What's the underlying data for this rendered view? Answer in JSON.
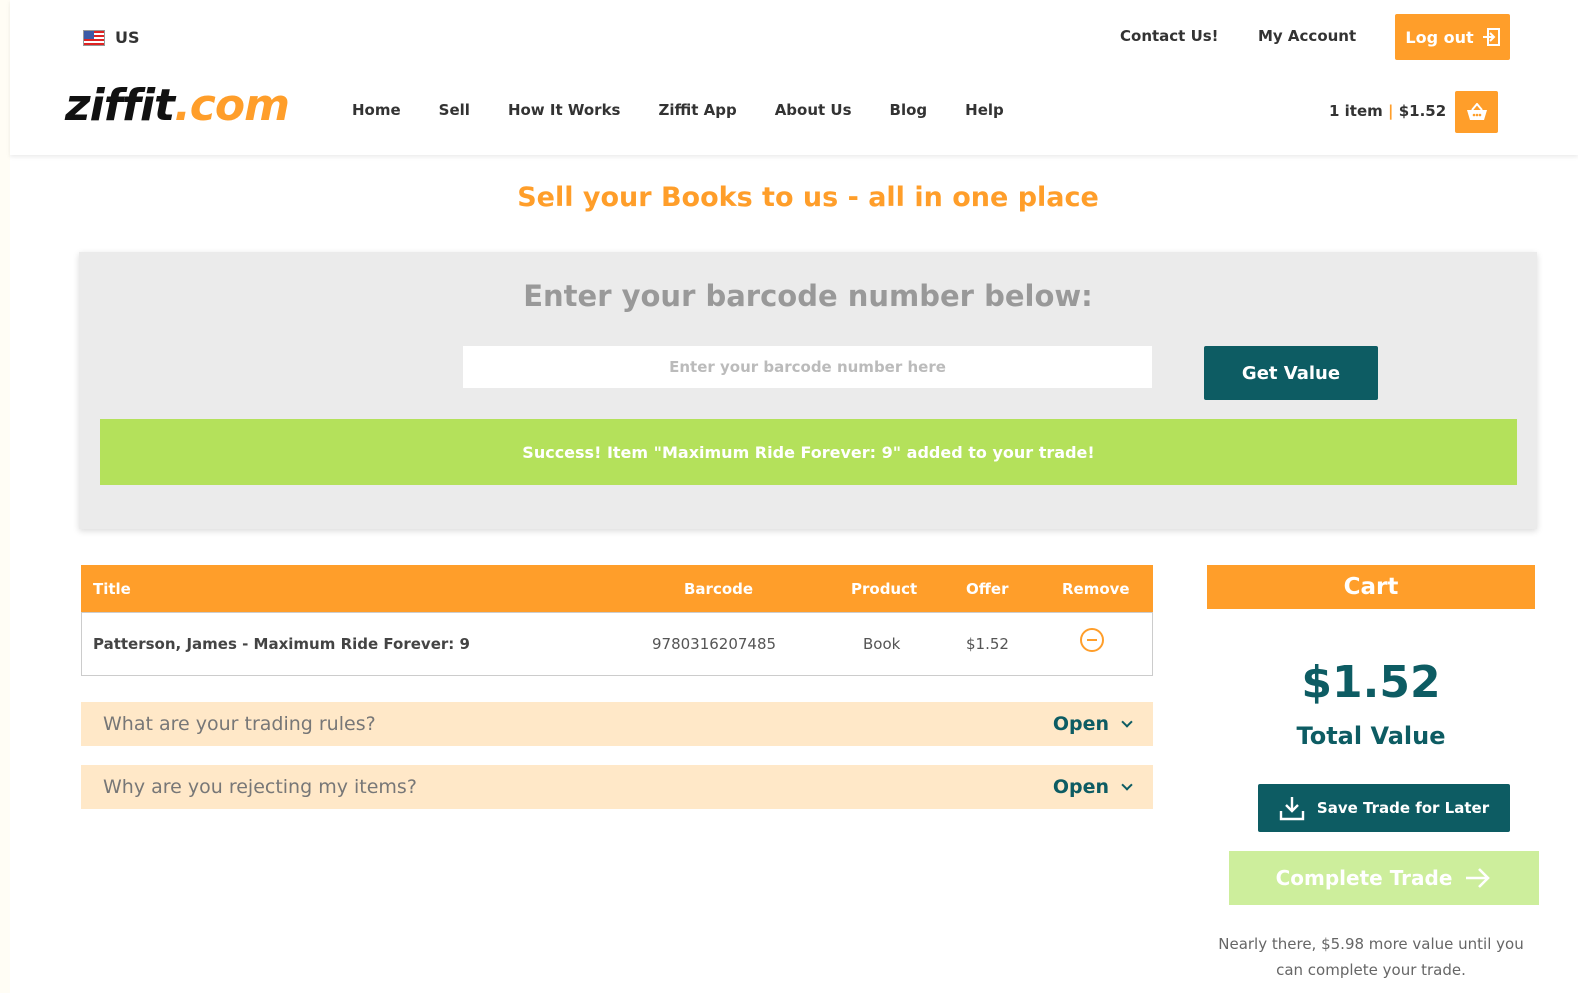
{
  "header": {
    "region": "US",
    "contact_label": "Contact Us!",
    "account_label": "My Account",
    "logout_label": "Log out",
    "logo_main": "ziffit",
    "logo_suffix": ".com",
    "nav": [
      "Home",
      "Sell",
      "How It Works",
      "Ziffit App",
      "About Us",
      "Blog",
      "Help"
    ],
    "cart_count": "1 item",
    "cart_separator": "|",
    "cart_amount": "$1.52"
  },
  "headline": "Sell your Books to us - all in one place",
  "barcode": {
    "title": "Enter your barcode number below:",
    "placeholder": "Enter your barcode number here",
    "value": "",
    "button_label": "Get Value"
  },
  "success_message": "Success! Item \"Maximum Ride Forever: 9\" added to your trade!",
  "table": {
    "headers": [
      "Title",
      "Barcode",
      "Product",
      "Offer",
      "Remove"
    ],
    "rows": [
      {
        "title": "Patterson, James - Maximum Ride Forever: 9",
        "barcode": "9780316207485",
        "product": "Book",
        "offer": "$1.52"
      }
    ]
  },
  "faqs": [
    {
      "question": "What are your trading rules?",
      "toggle": "Open"
    },
    {
      "question": "Why are you rejecting my items?",
      "toggle": "Open"
    }
  ],
  "cart": {
    "heading": "Cart",
    "total": "$1.52",
    "total_label": "Total Value",
    "save_label": "Save Trade for Later",
    "complete_label": "Complete Trade",
    "note": "Nearly there, $5.98 more value until you can complete your trade."
  },
  "colors": {
    "brand_orange": "#ff9e2a",
    "brand_teal": "#0d5c63",
    "success_green": "#b4e15b",
    "disabled_green": "#cdee9c",
    "faq_bg": "#ffe8c8"
  },
  "icons": [
    "us-flag-icon",
    "logout-icon",
    "basket-icon",
    "remove-circle-icon",
    "chevron-down-icon",
    "download-icon",
    "arrow-right-icon"
  ]
}
